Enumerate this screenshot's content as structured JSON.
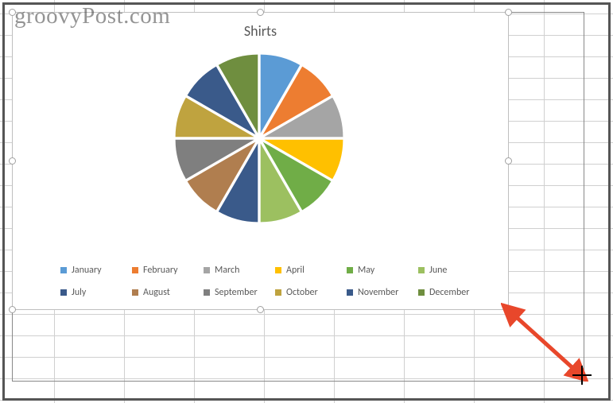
{
  "watermark": "groovyPost.com",
  "chart_data": {
    "type": "pie",
    "title": "Shirts",
    "categories": [
      "January",
      "February",
      "March",
      "April",
      "May",
      "June",
      "July",
      "August",
      "September",
      "October",
      "November",
      "December"
    ],
    "values": [
      1,
      1,
      1,
      1,
      1,
      1,
      1,
      1,
      1,
      1,
      1,
      1
    ],
    "series_notes": "Twelve equal slices; no numeric data labels shown on chart.",
    "colors": {
      "January": "#5B9BD5",
      "February": "#ED7D31",
      "March": "#A5A5A5",
      "April": "#FFC000",
      "May": "#70AD47",
      "June": "#4472C4",
      "July": "#B07E4F",
      "August": "#7F7F7F",
      "September": "#BFA33F",
      "October": "#3A5A8A",
      "November": "#6F8E3F",
      "December": "#4F7D3D"
    }
  },
  "legend": [
    {
      "label": "January",
      "color": "#5B9BD5"
    },
    {
      "label": "February",
      "color": "#ED7D31"
    },
    {
      "label": "March",
      "color": "#A5A5A5"
    },
    {
      "label": "April",
      "color": "#FFC000"
    },
    {
      "label": "May",
      "color": "#70AD47"
    },
    {
      "label": "June",
      "color": "#9CC060"
    },
    {
      "label": "July",
      "color": "#3A5A8A"
    },
    {
      "label": "August",
      "color": "#B07E4F"
    },
    {
      "label": "September",
      "color": "#7F7F7F"
    },
    {
      "label": "October",
      "color": "#BFA33F"
    },
    {
      "label": "November",
      "color": "#3A5A8A"
    },
    {
      "label": "December",
      "color": "#6F8E3F"
    }
  ],
  "pie_slices": [
    {
      "color": "#5B9BD5"
    },
    {
      "color": "#ED7D31"
    },
    {
      "color": "#A5A5A5"
    },
    {
      "color": "#FFC000"
    },
    {
      "color": "#70AD47"
    },
    {
      "color": "#9CC060"
    },
    {
      "color": "#3A5A8A"
    },
    {
      "color": "#B07E4F"
    },
    {
      "color": "#7F7F7F"
    },
    {
      "color": "#BFA33F"
    },
    {
      "color": "#3A5A8A"
    },
    {
      "color": "#6F8E3F"
    }
  ]
}
